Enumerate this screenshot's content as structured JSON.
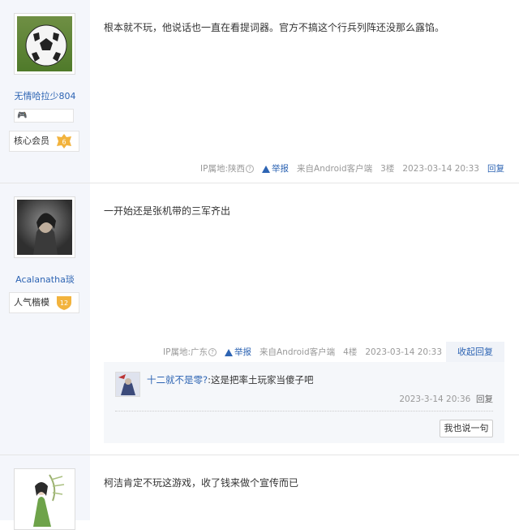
{
  "posts": [
    {
      "username": "无情哈拉少804",
      "badge_name": "核心会员",
      "badge_level": "6",
      "content": "根本就不玩，他说话也一直在看提词器。官方不搞这个行兵列阵还没那么露馅。",
      "ip_label": "IP属地:陕西",
      "report": "举报",
      "device": "来自Android客户端",
      "floor": "3楼",
      "time": "2023-03-14 20:33",
      "reply": "回复"
    },
    {
      "username": "Acalanatha琰",
      "badge_name": "人气楷模",
      "badge_level": "12",
      "content": "一开始还是张机带的三军齐出",
      "ip_label": "IP属地:广东",
      "report": "举报",
      "device": "来自Android客户端",
      "floor": "4楼",
      "time": "2023-03-14 20:33",
      "fold": "收起回复",
      "sub_reply": {
        "user": "十二就不是零?",
        "text": ":这是把率土玩家当傻子吧",
        "time": "2023-3-14 20:36",
        "reply": "回复",
        "button": "我也说一句"
      }
    },
    {
      "content": "柯洁肯定不玩这游戏，收了钱来做个宣传而已"
    }
  ],
  "colors": {
    "link": "#2d64b3",
    "sidebar": "#f4f6fb",
    "badge_gold": "#f2b33d"
  }
}
